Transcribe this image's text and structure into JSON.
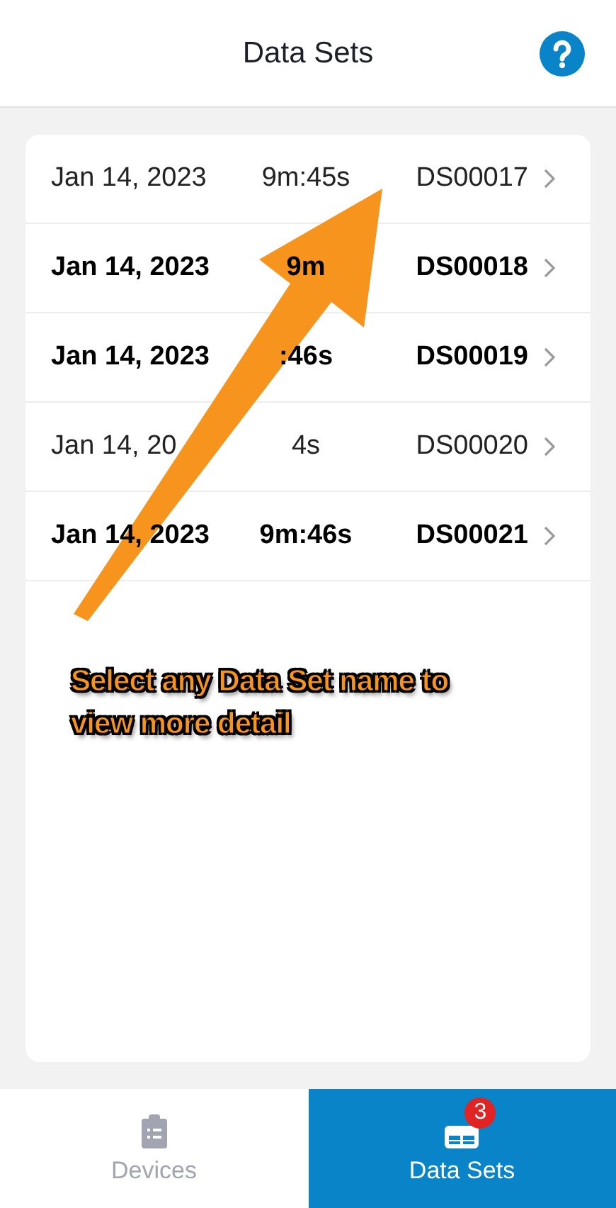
{
  "header": {
    "title": "Data Sets"
  },
  "rows": [
    {
      "date": "Jan 14, 2023",
      "duration": "9m:45s",
      "name": "DS00017",
      "unread": false
    },
    {
      "date": "Jan 14, 2023",
      "duration": "9m",
      "name": "DS00018",
      "unread": true
    },
    {
      "date": "Jan 14, 2023",
      "duration": ":46s",
      "name": "DS00019",
      "unread": true
    },
    {
      "date": "Jan 14, 20",
      "duration": "4s",
      "name": "DS00020",
      "unread": false
    },
    {
      "date": "Jan 14, 2023",
      "duration": "9m:46s",
      "name": "DS00021",
      "unread": true
    }
  ],
  "annotation": "Select any Data Set name to view more detail",
  "tabs": [
    {
      "label": "Devices",
      "kind": "devices",
      "selected": false
    },
    {
      "label": "Data Sets",
      "kind": "datasets",
      "selected": true,
      "badge": "3"
    }
  ]
}
